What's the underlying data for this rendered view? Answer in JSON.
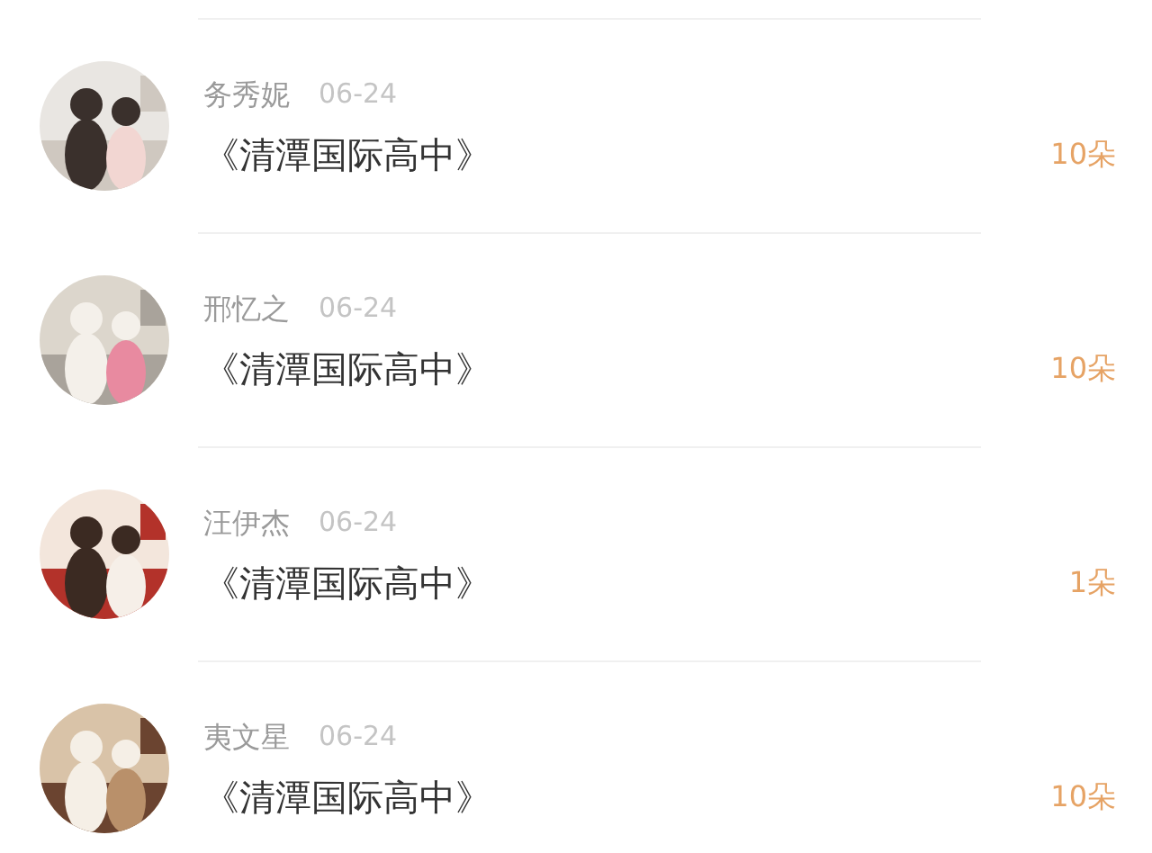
{
  "items": [
    {
      "name": "务秀妮",
      "date": "06-24",
      "title": "《清潭国际高中》",
      "count": "10朵"
    },
    {
      "name": "邢忆之",
      "date": "06-24",
      "title": "《清潭国际高中》",
      "count": "10朵"
    },
    {
      "name": "汪伊杰",
      "date": "06-24",
      "title": "《清潭国际高中》",
      "count": "1朵"
    },
    {
      "name": "夷文星",
      "date": "06-24",
      "title": "《清潭国际高中》",
      "count": "10朵"
    }
  ]
}
